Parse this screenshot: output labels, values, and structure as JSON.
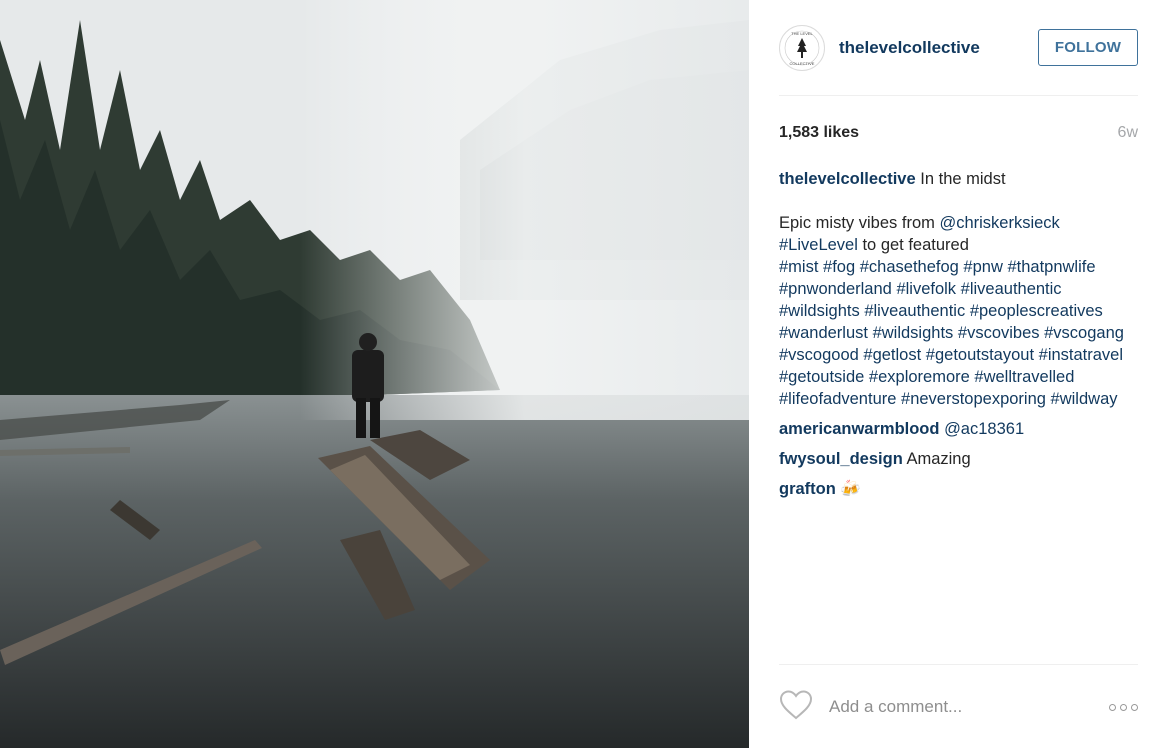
{
  "post": {
    "author": "thelevelcollective",
    "follow_label": "FOLLOW",
    "likes": "1,583 likes",
    "age": "6w",
    "caption": {
      "user": "thelevelcollective",
      "title": "In the midst",
      "line_prefix": "Epic misty vibes from ",
      "mention": "@chriskerksieck",
      "live_tag": "#LiveLevel",
      "live_suffix": " to get featured",
      "hashtags": [
        "#mist",
        "#fog",
        "#chasethefog",
        "#pnw",
        "#thatpnwlife",
        "#pnwonderland",
        "#livefolk",
        "#liveauthentic",
        "#wildsights",
        "#liveauthentic",
        "#peoplescreatives",
        "#wanderlust",
        "#wildsights",
        "#vscovibes",
        "#vscogang",
        "#vscogood",
        "#getlost",
        "#getoutstayout",
        "#instatravel",
        "#getoutside",
        "#exploremore",
        "#welltravelled",
        "#lifeofadventure",
        "#neverstopexporing",
        "#wildway"
      ]
    },
    "comments": [
      {
        "user": "americanwarmblood",
        "text": "@ac18361"
      },
      {
        "user": "fwysoul_design",
        "text": "Amazing"
      },
      {
        "user": "grafton",
        "text": "🍻"
      }
    ],
    "comment_placeholder": "Add a comment...",
    "avatar_text": "THE LEVEL COLLECTIVE"
  },
  "colors": {
    "link": "#12395e",
    "follow": "#3f729b",
    "muted": "#a5a7aa"
  }
}
